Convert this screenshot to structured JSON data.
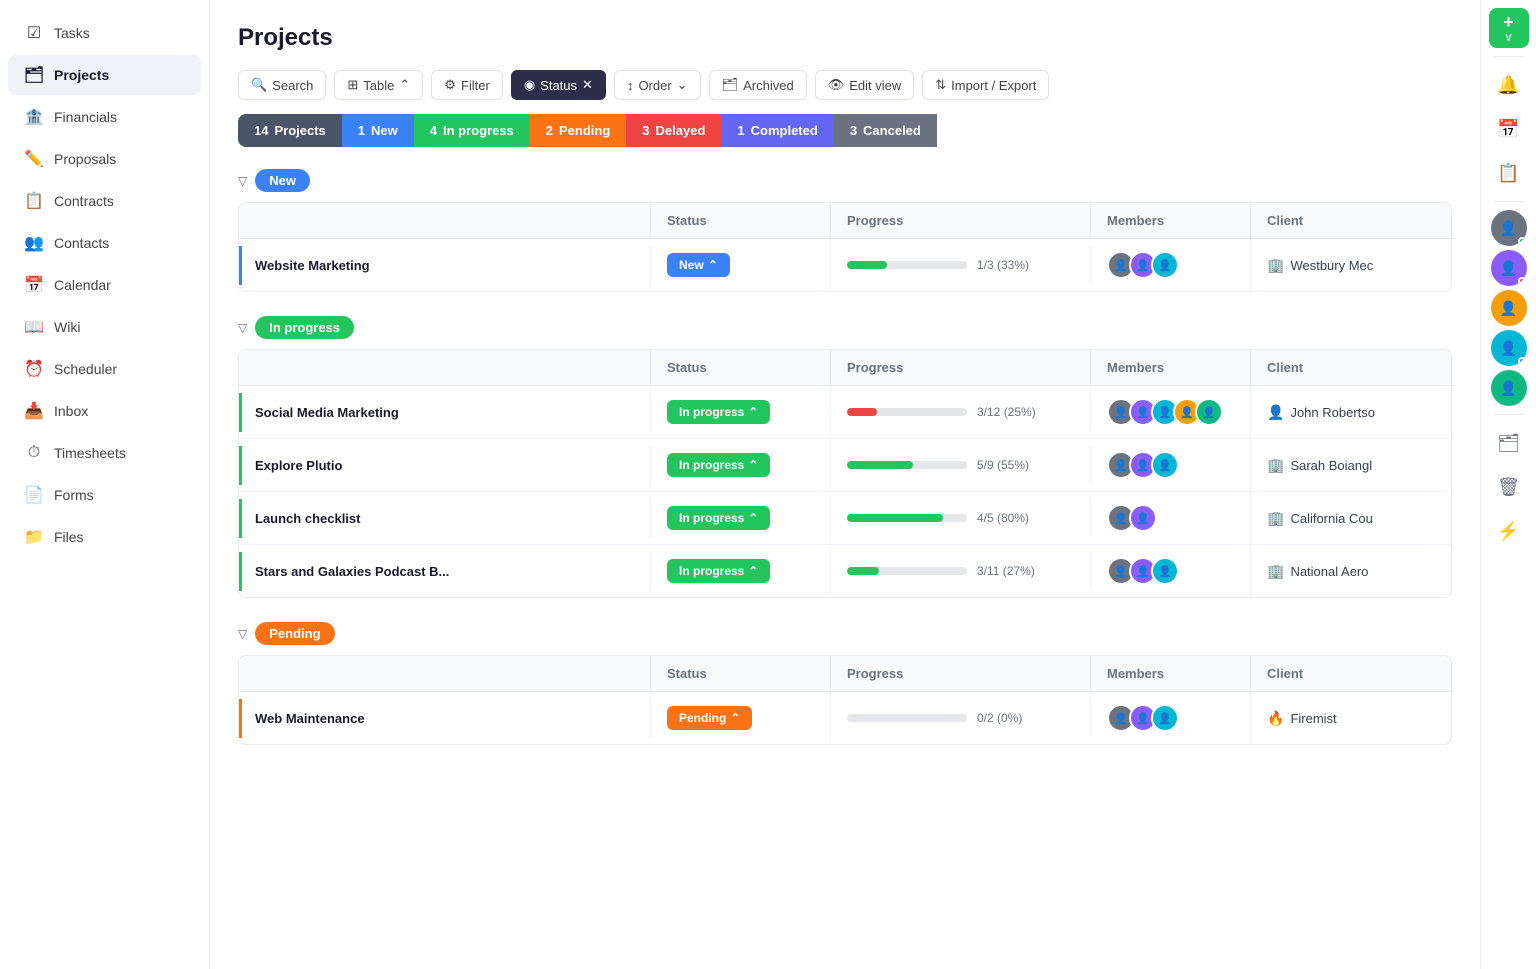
{
  "sidebar": {
    "items": [
      {
        "id": "tasks",
        "label": "Tasks",
        "icon": "☑"
      },
      {
        "id": "projects",
        "label": "Projects",
        "icon": "🗂",
        "active": true
      },
      {
        "id": "financials",
        "label": "Financials",
        "icon": "🏦"
      },
      {
        "id": "proposals",
        "label": "Proposals",
        "icon": "✏️"
      },
      {
        "id": "contracts",
        "label": "Contracts",
        "icon": "📋"
      },
      {
        "id": "contacts",
        "label": "Contacts",
        "icon": "👥"
      },
      {
        "id": "calendar",
        "label": "Calendar",
        "icon": "📅"
      },
      {
        "id": "wiki",
        "label": "Wiki",
        "icon": "📖"
      },
      {
        "id": "scheduler",
        "label": "Scheduler",
        "icon": "⏰"
      },
      {
        "id": "inbox",
        "label": "Inbox",
        "icon": "📥"
      },
      {
        "id": "timesheets",
        "label": "Timesheets",
        "icon": "⏱"
      },
      {
        "id": "forms",
        "label": "Forms",
        "icon": "📄"
      },
      {
        "id": "files",
        "label": "Files",
        "icon": "📁"
      }
    ]
  },
  "page": {
    "title": "Projects"
  },
  "toolbar": {
    "search_placeholder": "Search",
    "table_label": "Table",
    "filter_label": "Filter",
    "status_label": "Status",
    "order_label": "Order",
    "archived_label": "Archived",
    "edit_view_label": "Edit view",
    "import_export_label": "Import / Export"
  },
  "status_tabs": [
    {
      "label": "Projects",
      "count": "14",
      "type": "all"
    },
    {
      "label": "New",
      "count": "1",
      "type": "new"
    },
    {
      "label": "In progress",
      "count": "4",
      "type": "inprogress"
    },
    {
      "label": "Pending",
      "count": "2",
      "type": "pending"
    },
    {
      "label": "Delayed",
      "count": "3",
      "type": "delayed"
    },
    {
      "label": "Completed",
      "count": "1",
      "type": "completed"
    },
    {
      "label": "Canceled",
      "count": "3",
      "type": "canceled"
    }
  ],
  "groups": [
    {
      "id": "new",
      "label": "New",
      "type": "new",
      "columns": [
        "",
        "Status",
        "Progress",
        "Members",
        "Client"
      ],
      "rows": [
        {
          "name": "Website Marketing",
          "status": "New",
          "status_type": "new",
          "progress_fill": 33,
          "progress_label": "1/3 (33%)",
          "members": 3,
          "client": "Westbury Mec",
          "client_type": "company",
          "border_color": "blue"
        }
      ]
    },
    {
      "id": "inprogress",
      "label": "In progress",
      "type": "inprogress",
      "columns": [
        "",
        "Status",
        "Progress",
        "Members",
        "Client"
      ],
      "rows": [
        {
          "name": "Social Media Marketing",
          "status": "In progress",
          "status_type": "inprogress",
          "progress_fill": 25,
          "progress_label": "3/12 (25%)",
          "members": 5,
          "client": "John Robertso",
          "client_type": "person",
          "border_color": "green"
        },
        {
          "name": "Explore Plutio",
          "status": "In progress",
          "status_type": "inprogress",
          "progress_fill": 55,
          "progress_label": "5/9 (55%)",
          "members": 3,
          "client": "Sarah Boiangl",
          "client_type": "company",
          "border_color": "green"
        },
        {
          "name": "Launch checklist",
          "status": "In progress",
          "status_type": "inprogress",
          "progress_fill": 80,
          "progress_label": "4/5 (80%)",
          "members": 2,
          "client": "California Cou",
          "client_type": "company",
          "border_color": "green"
        },
        {
          "name": "Stars and Galaxies Podcast B...",
          "status": "In progress",
          "status_type": "inprogress",
          "progress_fill": 27,
          "progress_label": "3/11 (27%)",
          "members": 3,
          "client": "National Aero",
          "client_type": "company",
          "border_color": "green"
        }
      ]
    },
    {
      "id": "pending",
      "label": "Pending",
      "type": "pending",
      "columns": [
        "",
        "Status",
        "Progress",
        "Members",
        "Client"
      ],
      "rows": [
        {
          "name": "Web Maintenance",
          "status": "Pending",
          "status_type": "pending",
          "progress_fill": 0,
          "progress_label": "0/2 (0%)",
          "members": 3,
          "client": "Firemist",
          "client_type": "fire",
          "border_color": "orange"
        }
      ]
    }
  ],
  "right_panel": {
    "add_btn": "+",
    "icons": [
      "🔔",
      "📅",
      "📋",
      "🗂",
      "🗑",
      "⚡"
    ],
    "avatars": [
      {
        "label": "U1",
        "color": "#6b7280",
        "dot": "green"
      },
      {
        "label": "U2",
        "color": "#8b5cf6",
        "dot": "red"
      },
      {
        "label": "U3",
        "color": "#f59e0b",
        "dot": null
      },
      {
        "label": "U4",
        "color": "#06b6d4",
        "dot": "blue"
      },
      {
        "label": "U5",
        "color": "#10b981",
        "dot": null
      }
    ]
  }
}
